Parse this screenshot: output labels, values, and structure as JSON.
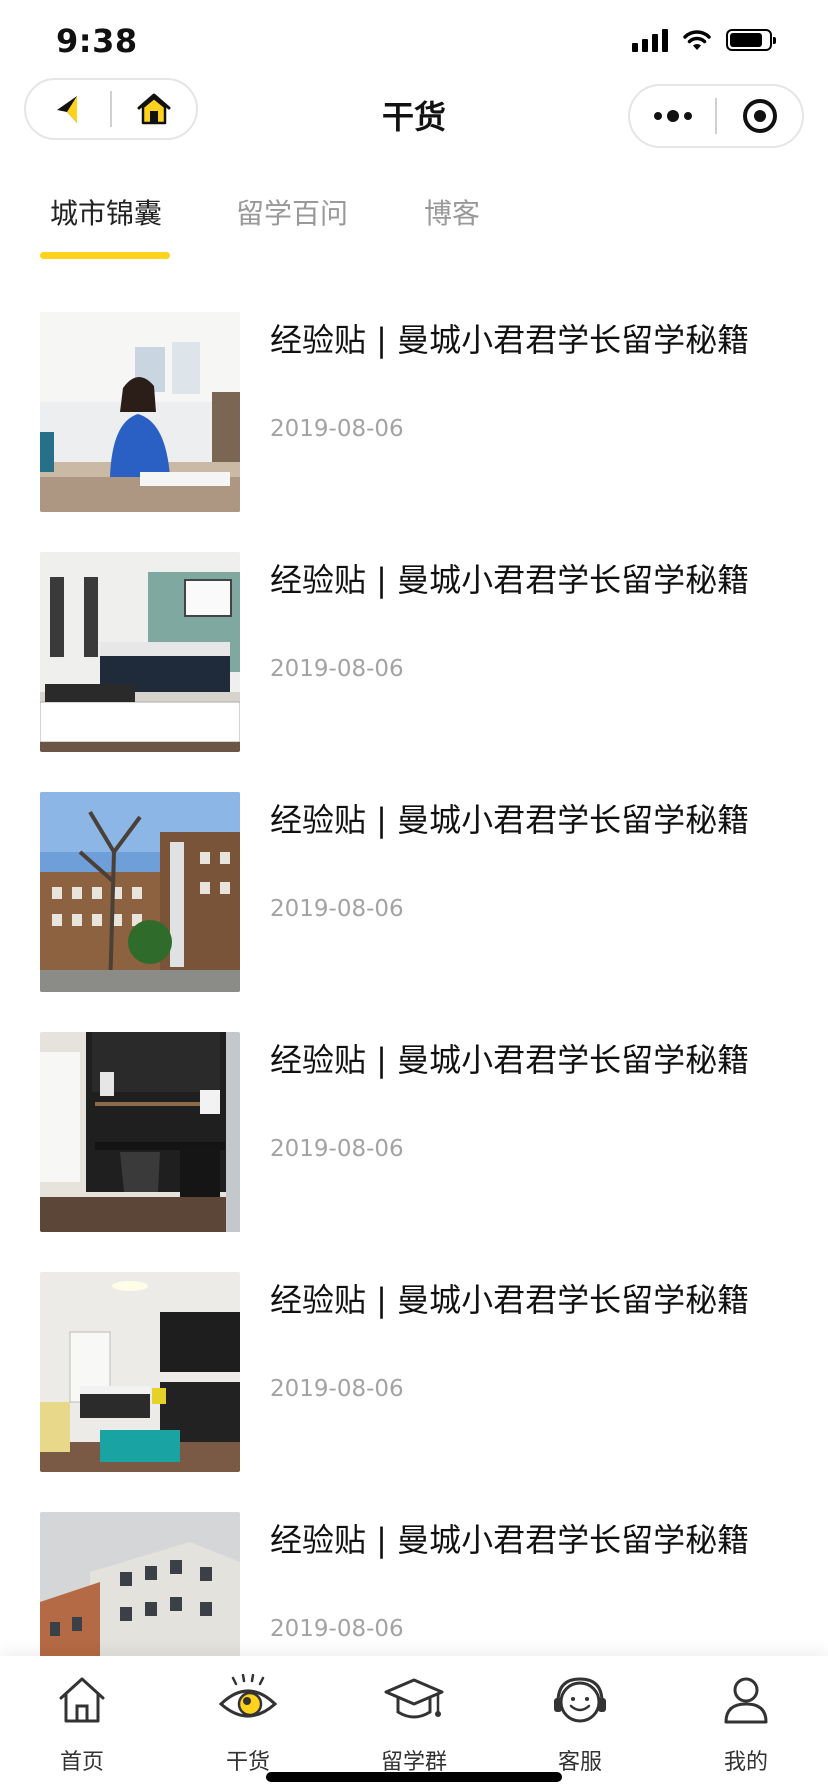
{
  "status_bar": {
    "time": "9:38",
    "battery_level": 0.85,
    "icons": [
      "signal-icon",
      "wifi-icon",
      "battery-icon"
    ]
  },
  "nav": {
    "title": "干货",
    "left_icons": [
      "back-arrow-icon",
      "home-icon"
    ],
    "right_icons": [
      "more-dots-icon",
      "close-target-icon"
    ]
  },
  "tabs": [
    {
      "label": "城市锦囊",
      "active": true
    },
    {
      "label": "留学百问",
      "active": false
    },
    {
      "label": "博客",
      "active": false
    }
  ],
  "colors": {
    "accent": "#ffd21e",
    "text_primary": "#111111",
    "text_secondary": "#a3a3a3"
  },
  "articles": [
    {
      "title": "经验贴 | 曼城小君君学长留学秘籍",
      "date": "2019-08-06",
      "image": "student-desk-photo"
    },
    {
      "title": "经验贴 | 曼城小君君学长留学秘籍",
      "date": "2019-08-06",
      "image": "bedroom-photo"
    },
    {
      "title": "经验贴 | 曼城小君君学长留学秘籍",
      "date": "2019-08-06",
      "image": "brick-building-photo"
    },
    {
      "title": "经验贴 | 曼城小君君学长留学秘籍",
      "date": "2019-08-06",
      "image": "study-desk-photo"
    },
    {
      "title": "经验贴 | 曼城小君君学长留学秘籍",
      "date": "2019-08-06",
      "image": "modern-room-photo"
    },
    {
      "title": "经验贴 | 曼城小君君学长留学秘籍",
      "date": "2019-08-06",
      "image": "apartment-exterior-photo"
    }
  ],
  "tabbar": [
    {
      "label": "首页",
      "icon": "house-icon"
    },
    {
      "label": "干货",
      "icon": "eye-icon",
      "active": true
    },
    {
      "label": "留学群",
      "icon": "graduation-cap-icon"
    },
    {
      "label": "客服",
      "icon": "headset-icon"
    },
    {
      "label": "我的",
      "icon": "user-icon"
    }
  ]
}
